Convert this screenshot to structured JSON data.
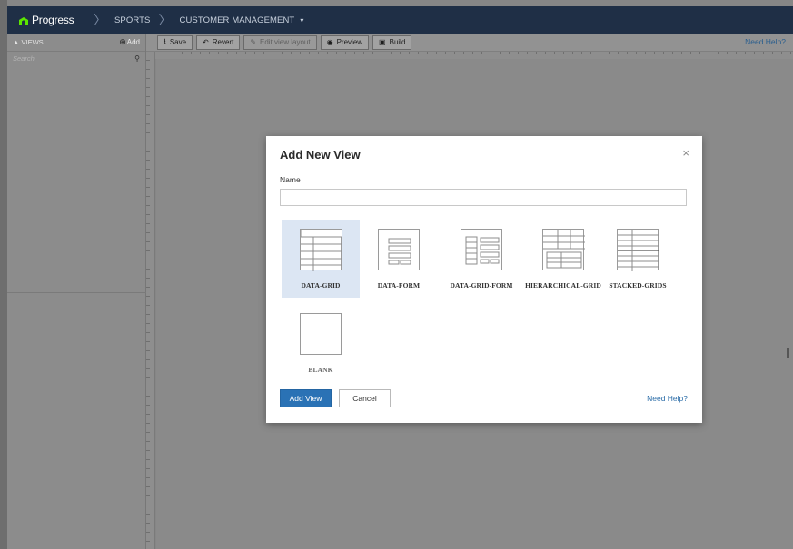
{
  "topbar": {
    "logo_text": "Progress",
    "breadcrumb": [
      "SPORTS",
      "CUSTOMER MANAGEMENT"
    ]
  },
  "left_panel": {
    "header_label": "VIEWS",
    "add_label": "Add",
    "search_placeholder": "Search"
  },
  "toolbar": {
    "save_label": "Save",
    "revert_label": "Revert",
    "edit_layout_label": "Edit view layout",
    "preview_label": "Preview",
    "build_label": "Build",
    "help_label": "Need Help?"
  },
  "modal": {
    "title": "Add New View",
    "close_glyph": "×",
    "name_label": "Name",
    "name_value": "",
    "tiles": [
      {
        "label": "DATA-GRID",
        "selected": true
      },
      {
        "label": "DATA-FORM",
        "selected": false
      },
      {
        "label": "DATA-GRID-FORM",
        "selected": false
      },
      {
        "label": "HIERARCHICAL-GRID",
        "selected": false
      },
      {
        "label": "STACKED-GRIDS",
        "selected": false
      },
      {
        "label": "BLANK",
        "selected": false
      }
    ],
    "add_button_label": "Add View",
    "cancel_button_label": "Cancel",
    "help_label": "Need Help?"
  },
  "colors": {
    "topbar_bg": "#1f2f46",
    "primary_button": "#2a72b5",
    "link": "#2d6ea9",
    "logo_green": "#5ce500",
    "selected_tile_bg": "#dce6f3"
  }
}
